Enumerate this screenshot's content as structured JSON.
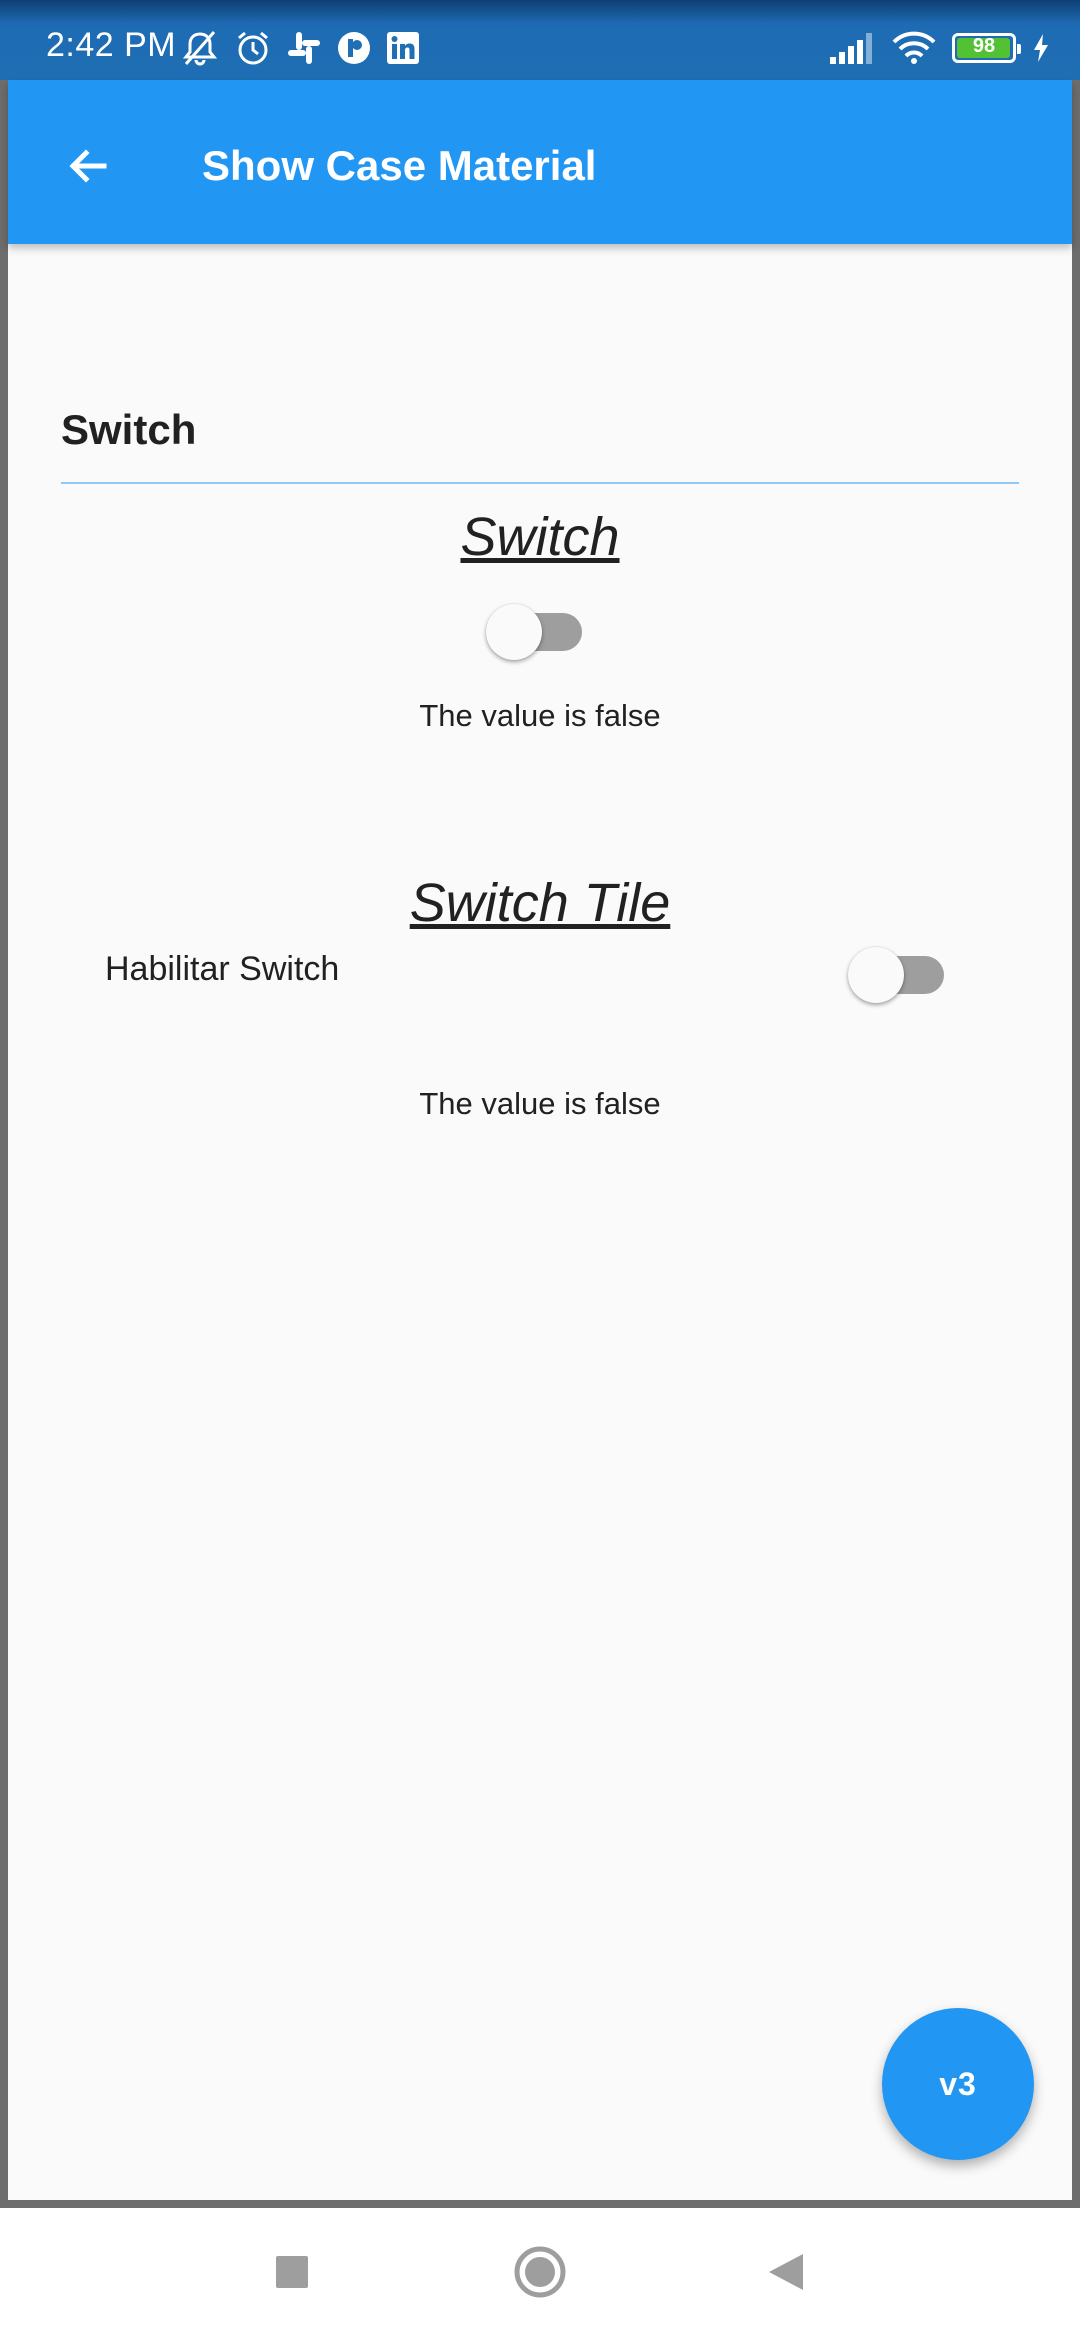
{
  "status_bar": {
    "time": "2:42 PM",
    "battery_level": "98",
    "battery_fraction": 0.98,
    "icons_left": [
      "muted-bell-icon",
      "alarm-icon",
      "slack-icon",
      "app-icon",
      "linkedin-icon"
    ],
    "icons_right": [
      "signal-icon",
      "wifi-icon",
      "battery-icon",
      "charging-icon"
    ]
  },
  "app_bar": {
    "title": "Show Case Material",
    "back_icon": "arrow-back-icon",
    "color": "#2196f3"
  },
  "main": {
    "section_title": "Switch",
    "switch_heading": "Switch",
    "switch_value_text": "The value is false",
    "switch_on": false,
    "tile_heading": "Switch Tile",
    "tile_label": "Habilitar Switch",
    "tile_switch_on": false,
    "tile_value_text": "The value is false"
  },
  "fab": {
    "label": "v3"
  },
  "nav_bar": {
    "buttons": [
      "recents-square-icon",
      "home-circle-icon",
      "back-triangle-icon"
    ]
  }
}
